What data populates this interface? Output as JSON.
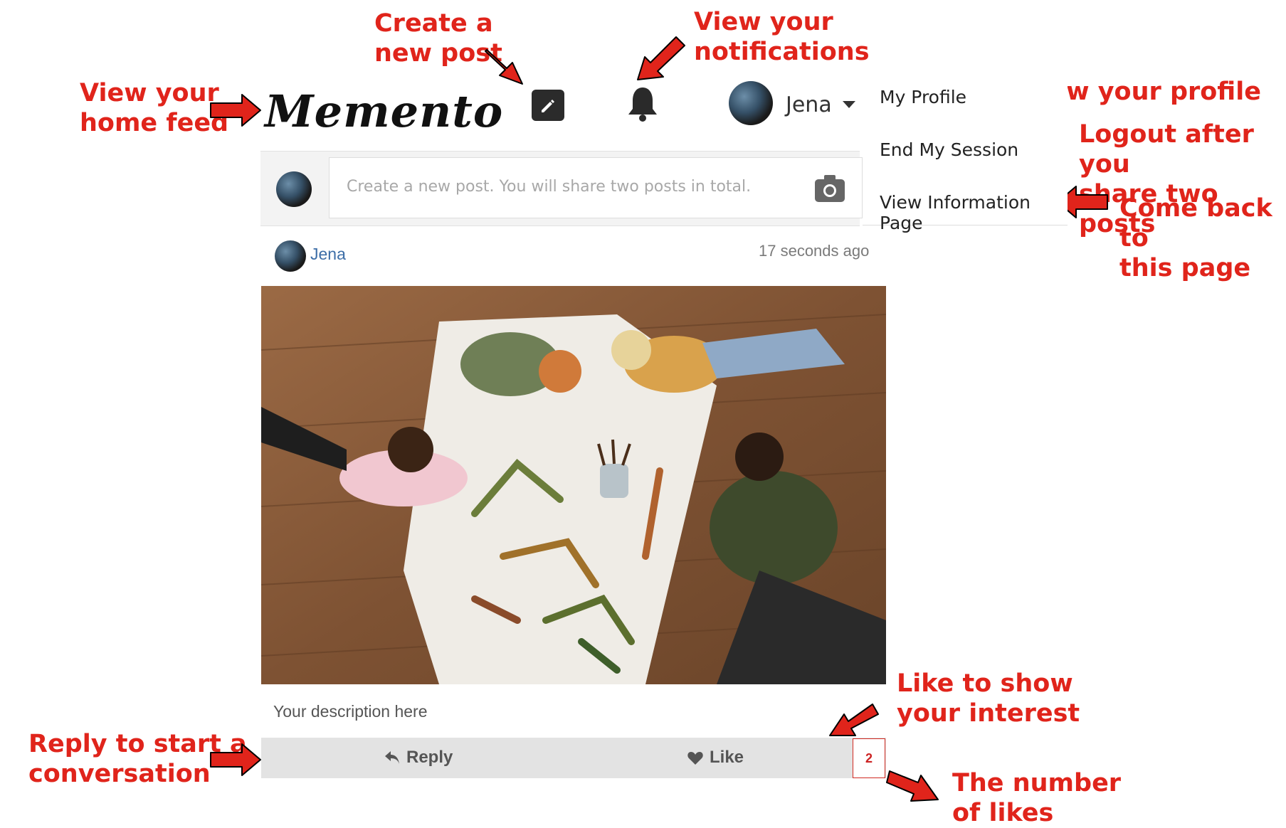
{
  "header": {
    "logo": "Memento",
    "user_name": "Jena",
    "icons": [
      "pencil-icon",
      "bell-icon",
      "chevron-down-icon"
    ]
  },
  "menu": {
    "items": [
      "My Profile",
      "End My Session",
      "View Information Page"
    ]
  },
  "composer": {
    "placeholder": "Create a new post. You will share two posts in total.",
    "camera_icon": "camera-icon"
  },
  "post": {
    "author": "Jena",
    "time": "17 seconds ago",
    "description": "Your description here",
    "reply_label": "Reply",
    "like_label": "Like",
    "like_count": "2"
  },
  "annotations": {
    "home_feed": "View your\nhome feed",
    "new_post": "Create a\nnew post",
    "notifications": "View your\nnotifications",
    "profile": "View your profile",
    "logout": "Logout after you\nshare two posts",
    "info_page": "Come back to\nthis page",
    "like": "Like to show\nyour interest",
    "reply": "Reply to start a\nconversation",
    "like_count": "The number\nof likes"
  },
  "colors": {
    "annotation": "#e0241b",
    "link": "#3d6ea7",
    "action_bar": "#e3e3e3"
  }
}
